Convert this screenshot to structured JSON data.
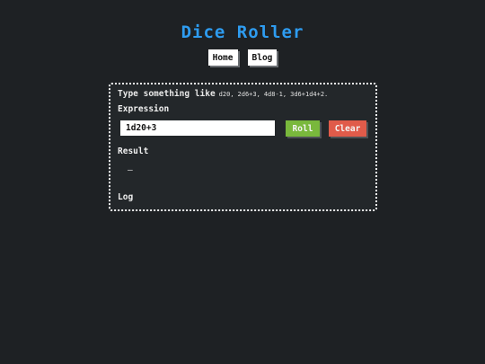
{
  "app": {
    "title": "Dice Roller"
  },
  "nav": {
    "items": [
      {
        "label": "Home"
      },
      {
        "label": "Blog"
      }
    ]
  },
  "roller": {
    "hint_text": "Type something like",
    "examples": [
      "d20,",
      "2d6+3,",
      "4d8-1,",
      "3d6+1d4+2."
    ],
    "expression_label": "Expression",
    "expression_value": "1d20+3",
    "roll_label": "Roll",
    "clear_label": "Clear",
    "result_label": "Result",
    "result_value": "–",
    "log_label": "Log"
  },
  "colors": {
    "background": "#1e2124",
    "title": "#2e9cf0",
    "roll_button": "#79b83c",
    "clear_button": "#e05b4a"
  }
}
